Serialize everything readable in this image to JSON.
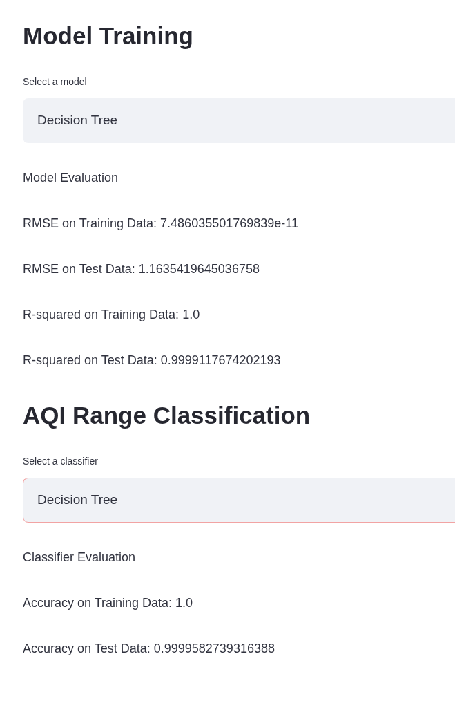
{
  "sections": [
    {
      "heading": "Model Training",
      "select": {
        "label": "Select a model",
        "value": "Decision Tree",
        "focused": false
      },
      "results": [
        "Model Evaluation",
        "RMSE on Training Data: 7.486035501769839e-11",
        "RMSE on Test Data: 1.1635419645036758",
        "R-squared on Training Data: 1.0",
        "R-squared on Test Data: 0.9999117674202193"
      ]
    },
    {
      "heading": "AQI Range Classification",
      "select": {
        "label": "Select a classifier",
        "value": "Decision Tree",
        "focused": true
      },
      "results": [
        "Classifier Evaluation",
        "Accuracy on Training Data: 1.0",
        "Accuracy on Test Data: 0.9999582739316388"
      ]
    }
  ]
}
